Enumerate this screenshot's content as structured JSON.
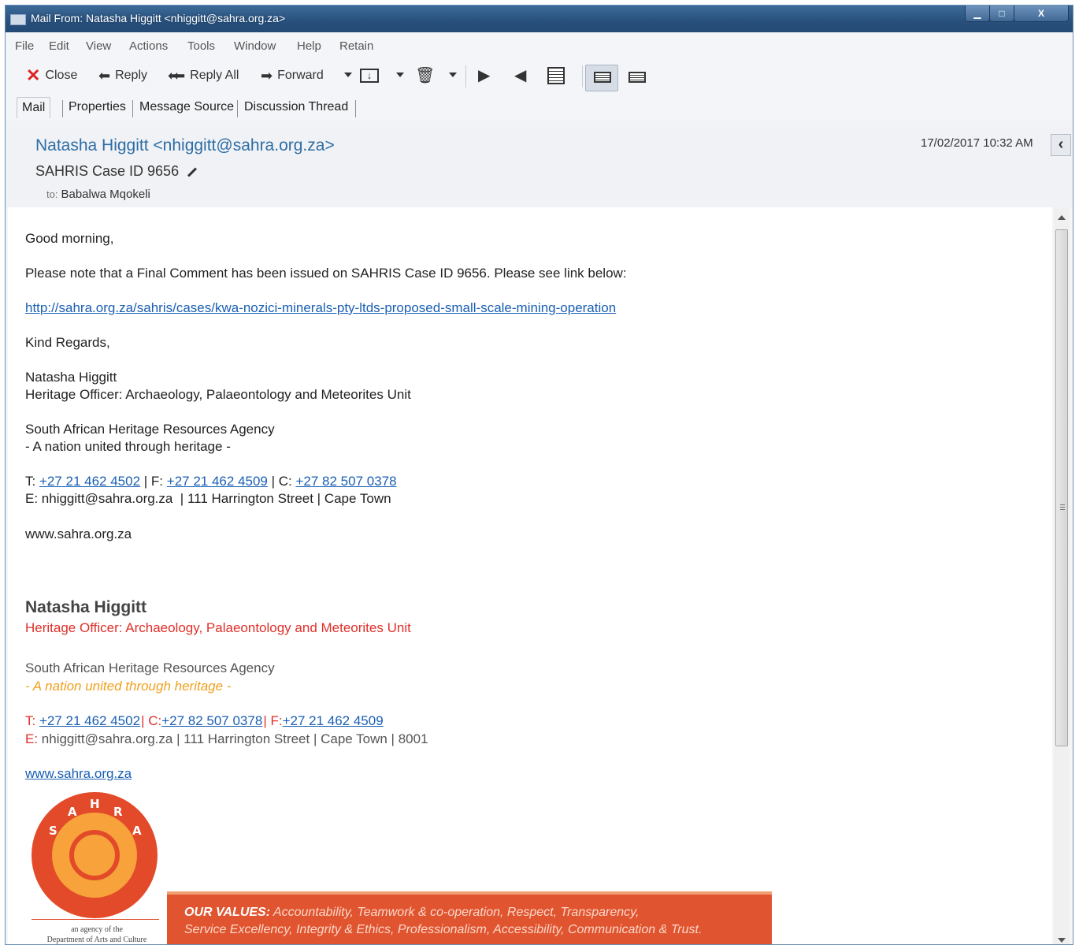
{
  "window": {
    "title": "Mail From: Natasha Higgitt <nhiggitt@sahra.org.za>",
    "minimize_label": "▁",
    "maximize_label": "□",
    "close_label": "X"
  },
  "menu": [
    "File",
    "Edit",
    "View",
    "Actions",
    "Tools",
    "Window",
    "Help",
    "Retain"
  ],
  "toolbar": {
    "close_label": "Close",
    "reply_label": "Reply",
    "reply_all_label": "Reply All",
    "forward_label": "Forward"
  },
  "tabs": [
    "Mail",
    "Properties",
    "Message Source",
    "Discussion Thread"
  ],
  "header": {
    "from": "Natasha Higgitt <nhiggitt@sahra.org.za>",
    "subject": "SAHRIS Case ID 9656",
    "to_label": "to:",
    "to": "Babalwa Mqokeli",
    "date": "17/02/2017 10:32 AM"
  },
  "message": {
    "greeting": "Good morning,",
    "line1": "Please note that a Final Comment has been issued on SAHRIS Case ID 9656. Please see link below:",
    "link": "http://sahra.org.za/sahris/cases/kwa-nozici-minerals-pty-ltds-proposed-small-scale-mining-operation",
    "regards": "Kind Regards,",
    "name": "Natasha Higgitt",
    "position": "Heritage Officer: Archaeology, Palaeontology and Meteorites Unit",
    "agency": "South African Heritage Resources Agency",
    "motto": "- A nation united through heritage -",
    "contact": {
      "t_label": "T: ",
      "t": "+27 21 462 4502",
      "f_label": " | F: ",
      "f": "+27 21 462 4509",
      "c_label": " | C: ",
      "c": "+27 82 507 0378"
    },
    "email_line": "E: nhiggitt@sahra.org.za  | 111 Harrington Street | Cape Town",
    "website": "www.sahra.org.za"
  },
  "signature": {
    "name": "Natasha Higgitt",
    "position": "Heritage Officer: Archaeology, Palaeontology and Meteorites Unit",
    "agency": "South African Heritage Resources Agency",
    "motto": "- A nation united through heritage -",
    "t_label": "T: ",
    "t": "+27 21 462 4502",
    "c_label": "| C:",
    "c": "+27 82 507 0378",
    "f_label": "| F:",
    "f": "+27 21 462 4509",
    "e_label": "E:",
    "e_text": " nhiggitt@sahra.org.za | 111 Harrington Street | Cape Town | 8001",
    "website": "www.sahra.org.za",
    "logo_letters": [
      "S",
      "A",
      "H",
      "R",
      "A"
    ],
    "agency_of_line1": "an agency of the",
    "agency_of_line2": "Department of Arts and Culture",
    "values_label": "OUR VALUES:",
    "values_line1": " Accountability, Teamwork & co-operation, Respect, Transparency,",
    "values_line2": "Service Excellency, Integrity & Ethics, Professionalism, Accessibility, Communication & Trust."
  },
  "colors": {
    "link": "#1a5fb4",
    "accent_red": "#e0302a",
    "motto_orange": "#f0a01e",
    "values_bg": "#e05430",
    "titlebar": "#28507c"
  }
}
